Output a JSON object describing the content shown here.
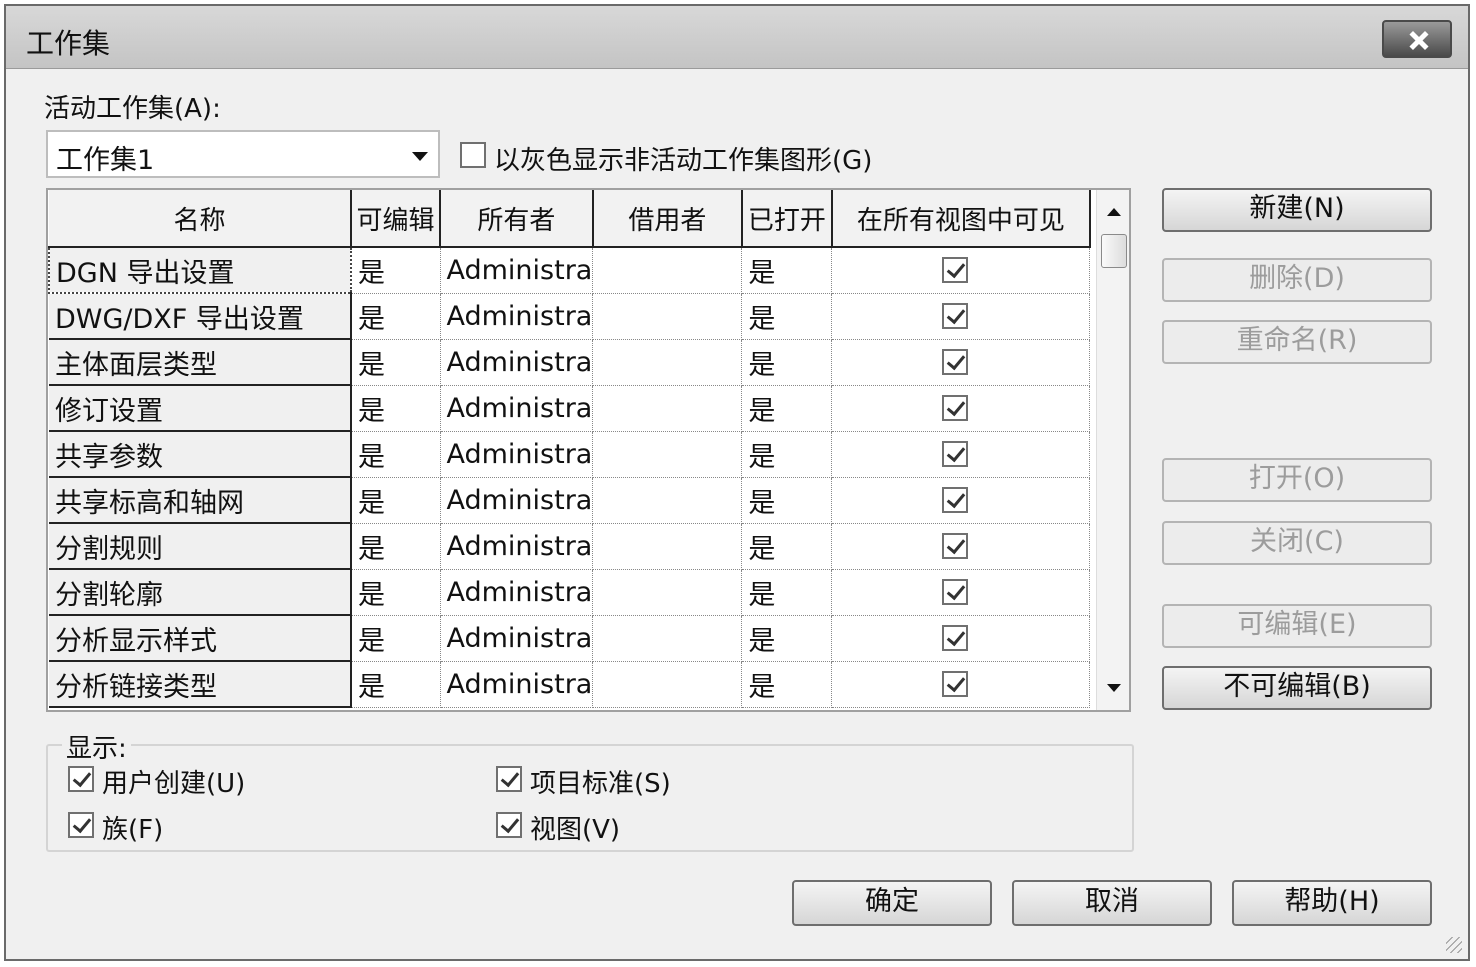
{
  "window": {
    "title": "工作集"
  },
  "active_workset": {
    "label": "活动工作集(A):",
    "value": "工作集1",
    "gray_inactive": {
      "label": "以灰色显示非活动工作集图形(G)",
      "checked": false
    }
  },
  "table": {
    "columns": [
      "名称",
      "可编辑",
      "所有者",
      "借用者",
      "已打开",
      "在所有视图中可见"
    ],
    "rows": [
      {
        "name": "DGN 导出设置",
        "editable": "是",
        "owner": "Administra",
        "borrower": "",
        "opened": "是",
        "visible": true
      },
      {
        "name": "DWG/DXF 导出设置",
        "editable": "是",
        "owner": "Administra",
        "borrower": "",
        "opened": "是",
        "visible": true
      },
      {
        "name": "主体面层类型",
        "editable": "是",
        "owner": "Administra",
        "borrower": "",
        "opened": "是",
        "visible": true
      },
      {
        "name": "修订设置",
        "editable": "是",
        "owner": "Administra",
        "borrower": "",
        "opened": "是",
        "visible": true
      },
      {
        "name": "共享参数",
        "editable": "是",
        "owner": "Administra",
        "borrower": "",
        "opened": "是",
        "visible": true
      },
      {
        "name": "共享标高和轴网",
        "editable": "是",
        "owner": "Administra",
        "borrower": "",
        "opened": "是",
        "visible": true
      },
      {
        "name": "分割规则",
        "editable": "是",
        "owner": "Administra",
        "borrower": "",
        "opened": "是",
        "visible": true
      },
      {
        "name": "分割轮廓",
        "editable": "是",
        "owner": "Administra",
        "borrower": "",
        "opened": "是",
        "visible": true
      },
      {
        "name": "分析显示样式",
        "editable": "是",
        "owner": "Administra",
        "borrower": "",
        "opened": "是",
        "visible": true
      },
      {
        "name": "分析链接类型",
        "editable": "是",
        "owner": "Administra",
        "borrower": "",
        "opened": "是",
        "visible": true
      }
    ]
  },
  "side_buttons": {
    "new": "新建(N)",
    "delete": "删除(D)",
    "rename": "重命名(R)",
    "open": "打开(O)",
    "close": "关闭(C)",
    "editable": "可编辑(E)",
    "non_editable": "不可编辑(B)"
  },
  "display": {
    "title": "显示:",
    "user_created": {
      "label": "用户创建(U)",
      "checked": true
    },
    "project_standards": {
      "label": "项目标准(S)",
      "checked": true
    },
    "families": {
      "label": "族(F)",
      "checked": true
    },
    "views": {
      "label": "视图(V)",
      "checked": true
    }
  },
  "footer": {
    "ok": "确定",
    "cancel": "取消",
    "help": "帮助(H)"
  }
}
